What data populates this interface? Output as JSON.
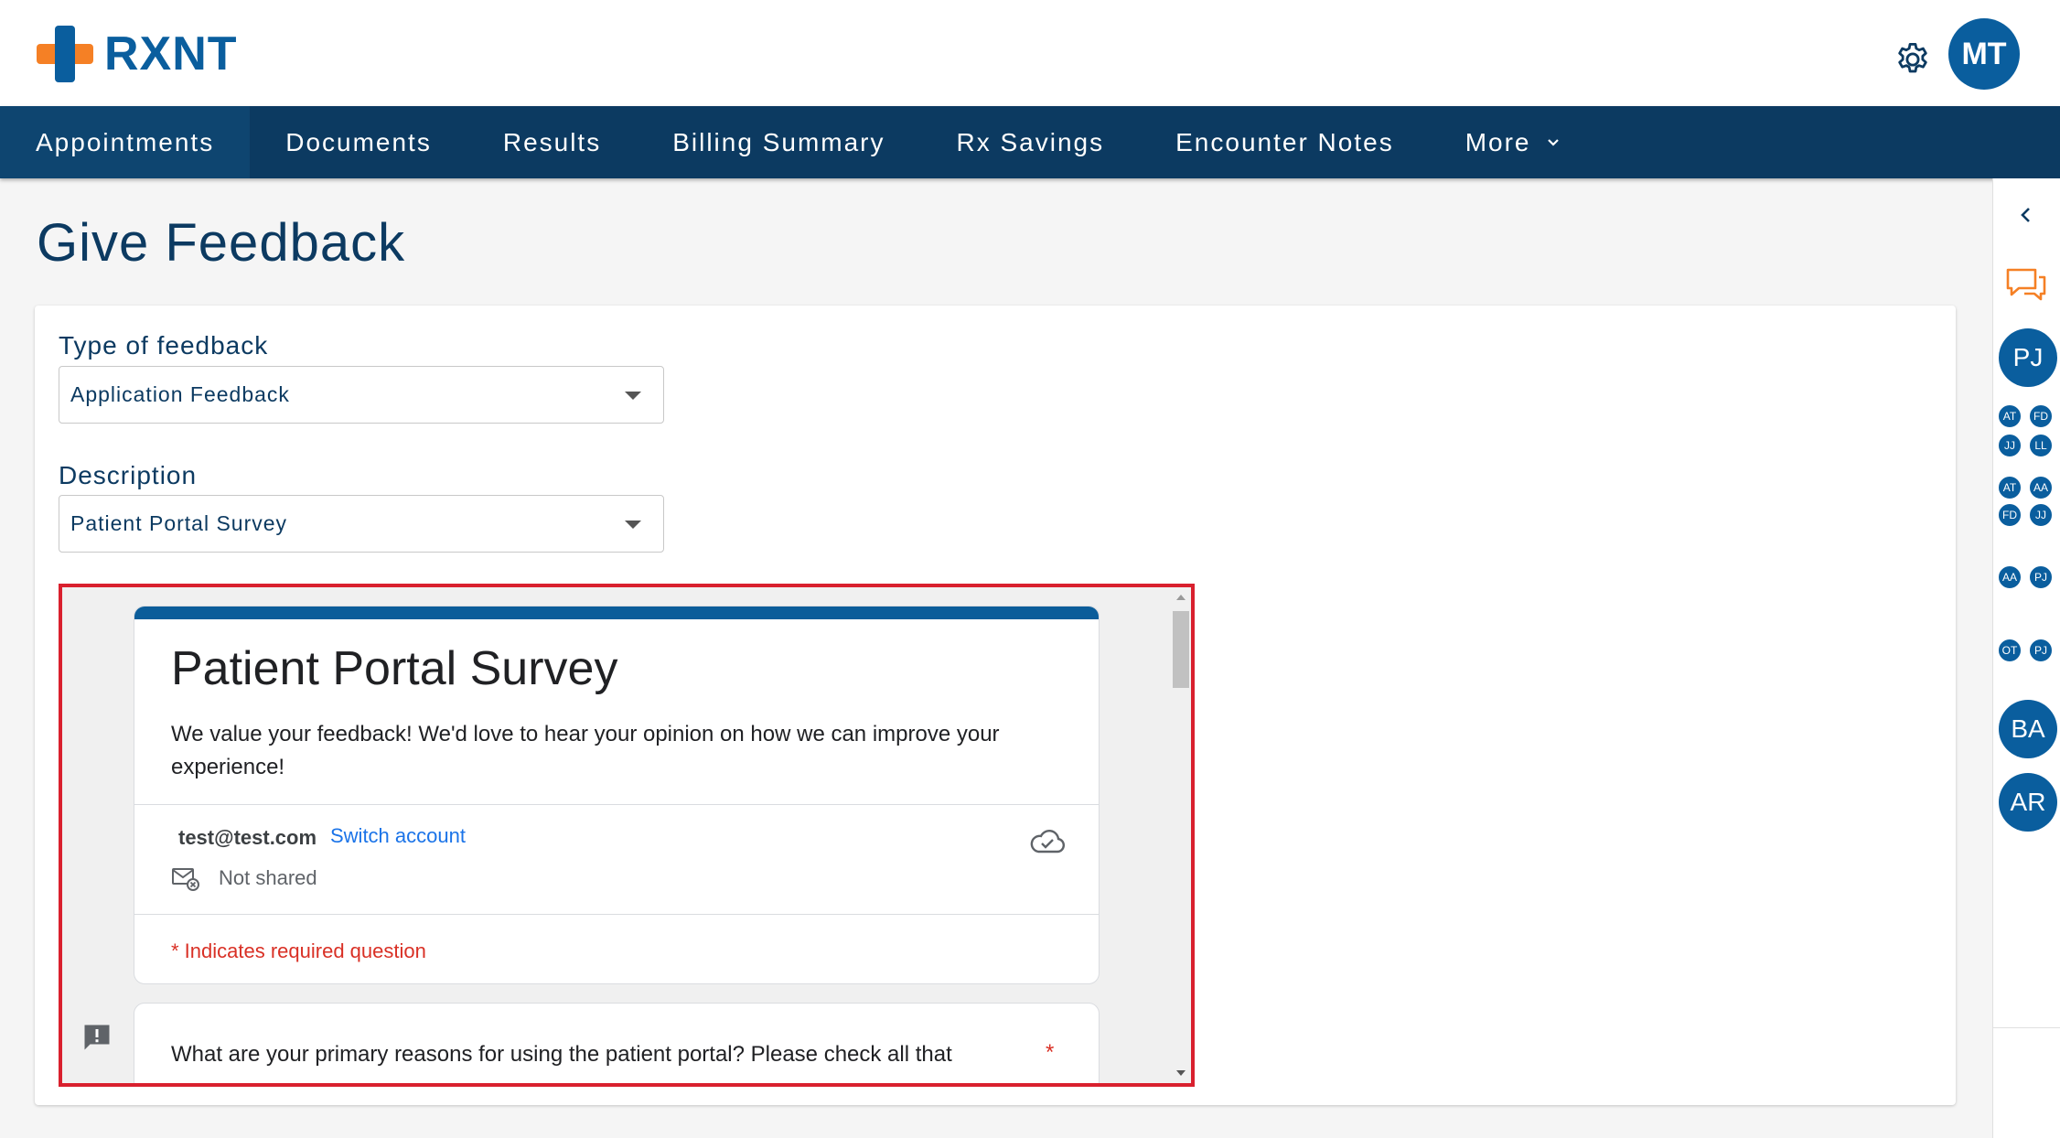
{
  "brand": {
    "name": "RXNT",
    "colors": {
      "primary": "#0a5e9e",
      "accent": "#f58025",
      "nav": "#0c3a61",
      "required": "#d93025",
      "link": "#1a73e8"
    }
  },
  "header": {
    "user_initials": "MT",
    "settings_icon": "gear-icon"
  },
  "nav": {
    "items": [
      "Appointments",
      "Documents",
      "Results",
      "Billing Summary",
      "Rx Savings",
      "Encounter Notes"
    ],
    "more_label": "More"
  },
  "page": {
    "title": "Give Feedback"
  },
  "form": {
    "type_label": "Type of feedback",
    "type_value": "Application Feedback",
    "description_label": "Description",
    "description_value": "Patient Portal Survey"
  },
  "survey": {
    "title": "Patient Portal Survey",
    "description": "We value your feedback! We'd love to hear your opinion on how we can improve your experience!",
    "email": "test@test.com",
    "switch_account": "Switch account",
    "not_shared": "Not shared",
    "required_note": "* Indicates required question",
    "question_1": "What are your primary reasons for using the patient portal? Please check all that",
    "required_star": "*"
  },
  "sidebar": {
    "large_avatars_top": [
      "PJ"
    ],
    "group_1": [
      "AT",
      "FD",
      "JJ",
      "LL"
    ],
    "group_2": [
      "AT",
      "AA",
      "FD",
      "JJ"
    ],
    "group_3": [
      "AA",
      "PJ"
    ],
    "group_4": [
      "OT",
      "PJ"
    ],
    "large_avatars_bottom": [
      "BA",
      "AR"
    ]
  }
}
